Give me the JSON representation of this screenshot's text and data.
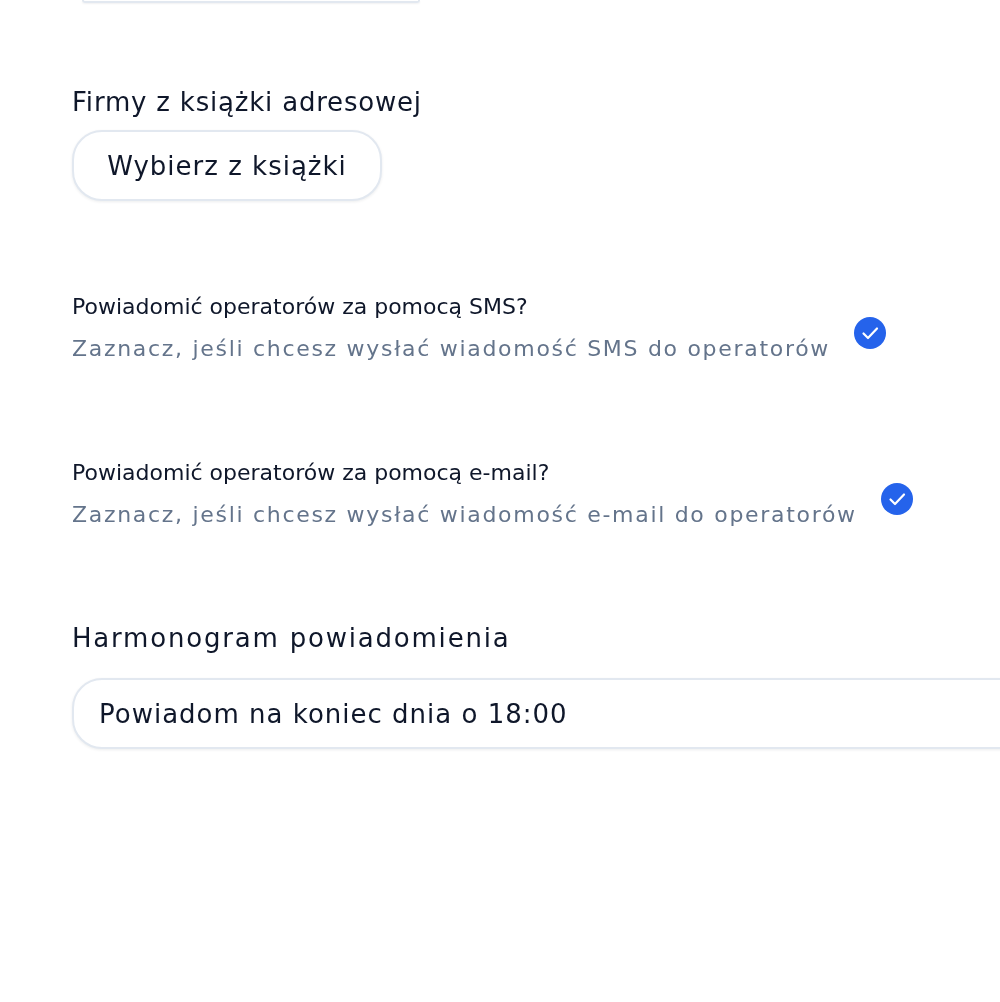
{
  "address_book": {
    "label": "Firmy z książki adresowej",
    "button": "Wybierz z książki"
  },
  "notifications": [
    {
      "kind": "checkbox",
      "title": "Powiadomić operatorów za pomocą SMS?",
      "description": "Zaznacz, jeśli chcesz wysłać wiadomość SMS do operatorów",
      "checked": true
    },
    {
      "kind": "checkbox",
      "title": "Powiadomić operatorów za pomocą e-mail?",
      "description": "Zaznacz, jeśli chcesz wysłać wiadomość e-mail do operatorów",
      "checked": true
    }
  ],
  "schedule": {
    "label": "Harmonogram powiadomienia",
    "value": "Powiadom na koniec dnia o 18:00"
  }
}
